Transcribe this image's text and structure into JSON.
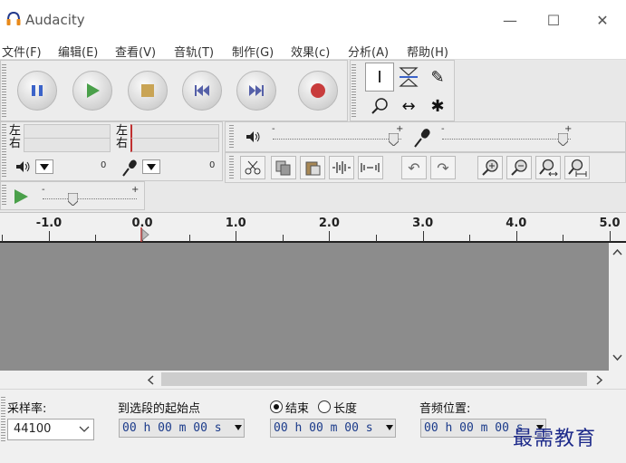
{
  "window": {
    "title": "Audacity",
    "minimize_glyph": "—",
    "maximize_glyph": "☐",
    "close_glyph": "✕"
  },
  "menu": [
    "文件(F)",
    "编辑(E)",
    "查看(V)",
    "音轨(T)",
    "制作(G)",
    "效果(c)",
    "分析(A)",
    "帮助(H)"
  ],
  "meters": {
    "left_label": "左",
    "right_label": "右",
    "playback_max": "0",
    "record_max": "0"
  },
  "tool_glyphs": {
    "select": "I",
    "zoom": "⌕",
    "timeshift": "↔",
    "multi": "✱",
    "draw": "✎"
  },
  "history_glyphs": {
    "undo": "↶",
    "redo": "↷"
  },
  "mixer": {
    "output_minus": "-",
    "output_plus": "+",
    "input_minus": "-",
    "input_plus": "+",
    "output_volume": 0.98,
    "input_volume": 0.98
  },
  "play_at_speed": {
    "minus": "-",
    "plus": "+",
    "speed": 0.3
  },
  "ruler": {
    "ticks": [
      "-1.0",
      "0.0",
      "1.0",
      "2.0",
      "3.0",
      "4.0",
      "5.0"
    ]
  },
  "status": {
    "rate_label": "采样率:",
    "rate_value": "44100",
    "selection_start_label": "到选段的起始点",
    "end_label": "结束",
    "length_label": "长度",
    "audio_position_label": "音频位置:",
    "time_value": "00 h 00 m 00 s"
  },
  "watermark": "最需教育",
  "colors": {
    "accent_blue": "#3b63c9",
    "record_red": "#c83c3c",
    "play_green": "#4aa04a",
    "playhead_red": "#c03030"
  }
}
